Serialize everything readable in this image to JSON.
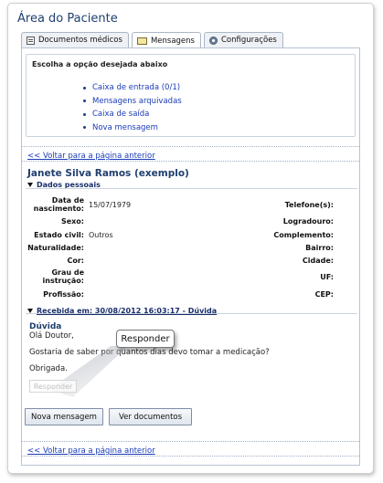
{
  "page": {
    "title": "Área do Paciente"
  },
  "tabs": [
    {
      "label": "Documentos médicos",
      "icon": "document-icon",
      "active": false
    },
    {
      "label": "Mensagens",
      "icon": "envelope-icon",
      "active": true
    },
    {
      "label": "Configurações",
      "icon": "gear-icon",
      "active": false
    }
  ],
  "options": {
    "legend": "Escolha a opção desejada abaixo",
    "items": [
      "Caixa de entrada (0/1)",
      "Mensagens arquivadas",
      "Caixa de saída",
      "Nova mensagem"
    ]
  },
  "back_link": "<< Voltar para a página anterior",
  "patient": {
    "name": "Janete Silva Ramos (exemplo)",
    "section_label": "Dados pessoais",
    "fields_left": [
      {
        "label": "Data de nascimento:",
        "value": "15/07/1979"
      },
      {
        "label": "Sexo:",
        "value": ""
      },
      {
        "label": "Estado civil:",
        "value": "Outros"
      },
      {
        "label": "Naturalidade:",
        "value": ""
      },
      {
        "label": "Cor:",
        "value": ""
      },
      {
        "label": "Grau de instrução:",
        "value": ""
      },
      {
        "label": "Profissão:",
        "value": ""
      }
    ],
    "fields_right": [
      {
        "label": "Telefone(s):",
        "value": ""
      },
      {
        "label": "Logradouro:",
        "value": ""
      },
      {
        "label": "Complemento:",
        "value": ""
      },
      {
        "label": "Bairro:",
        "value": ""
      },
      {
        "label": "Cidade:",
        "value": ""
      },
      {
        "label": "UF:",
        "value": ""
      },
      {
        "label": "CEP:",
        "value": ""
      }
    ]
  },
  "message": {
    "header": "Recebida em: 30/08/2012 16:03:17 - Dúvida",
    "subject": "Dúvida",
    "greeting": "Olá Doutor,",
    "body": "Gostaria de saber por quantos dias devo tomar a medicação?",
    "closing": "Obrigada.",
    "reply_ghost": "Responder",
    "callout": "Responder"
  },
  "buttons": {
    "new_message": "Nova mensagem",
    "view_documents": "Ver documentos"
  },
  "colors": {
    "title": "#1f3f6e",
    "link": "#1a3bb8",
    "border": "#b8c3d2"
  }
}
